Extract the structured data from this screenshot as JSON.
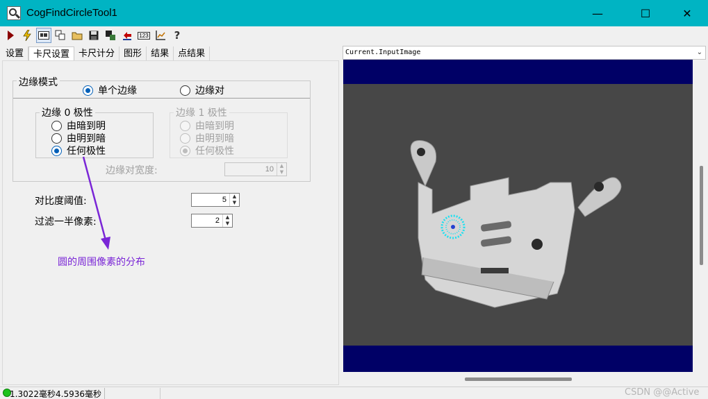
{
  "window": {
    "title": "CogFindCircleTool1",
    "accent": "#00b4c3",
    "minimize_glyph": "—",
    "maximize_glyph": "☐",
    "close_glyph": "✕"
  },
  "toolbar": {
    "icons": [
      "run-icon",
      "lightning-icon",
      "display-toggle-icon",
      "copy-image-icon",
      "open-folder-icon",
      "save-icon",
      "save-settings-icon",
      "restore-icon",
      "numeric-icon",
      "graph-icon",
      "help-icon"
    ],
    "numeric_label": "123",
    "help_glyph": "?"
  },
  "tabs": [
    "设置",
    "卡尺设置",
    "卡尺计分",
    "图形",
    "结果",
    "点结果"
  ],
  "edge_mode": {
    "title": "边缘模式",
    "single": "单个边缘",
    "pair": "边缘对",
    "selected": "单个边缘"
  },
  "edge0": {
    "title": "边缘 0 极性",
    "options": [
      "由暗到明",
      "由明到暗",
      "任何极性"
    ],
    "selected": "任何极性"
  },
  "edge1": {
    "title": "边缘 1 极性",
    "options": [
      "由暗到明",
      "由明到暗",
      "任何极性"
    ],
    "selected": "任何极性"
  },
  "edge_pair_width": {
    "label": "边缘对宽度:",
    "value": "10"
  },
  "contrast_threshold": {
    "label": "对比度阈值:",
    "value": "5"
  },
  "filter_half_pixels": {
    "label": "过滤一半像素:",
    "value": "2"
  },
  "annotation": {
    "text": "圆的周围像素的分布",
    "color": "#7a26d6"
  },
  "image_panel": {
    "selector": "Current.InputImage",
    "background": "#000066"
  },
  "status": {
    "text": "1.3022毫秒4.5936毫秒",
    "indicator_color": "#1cc21c"
  },
  "watermark": "CSDN @@Active"
}
